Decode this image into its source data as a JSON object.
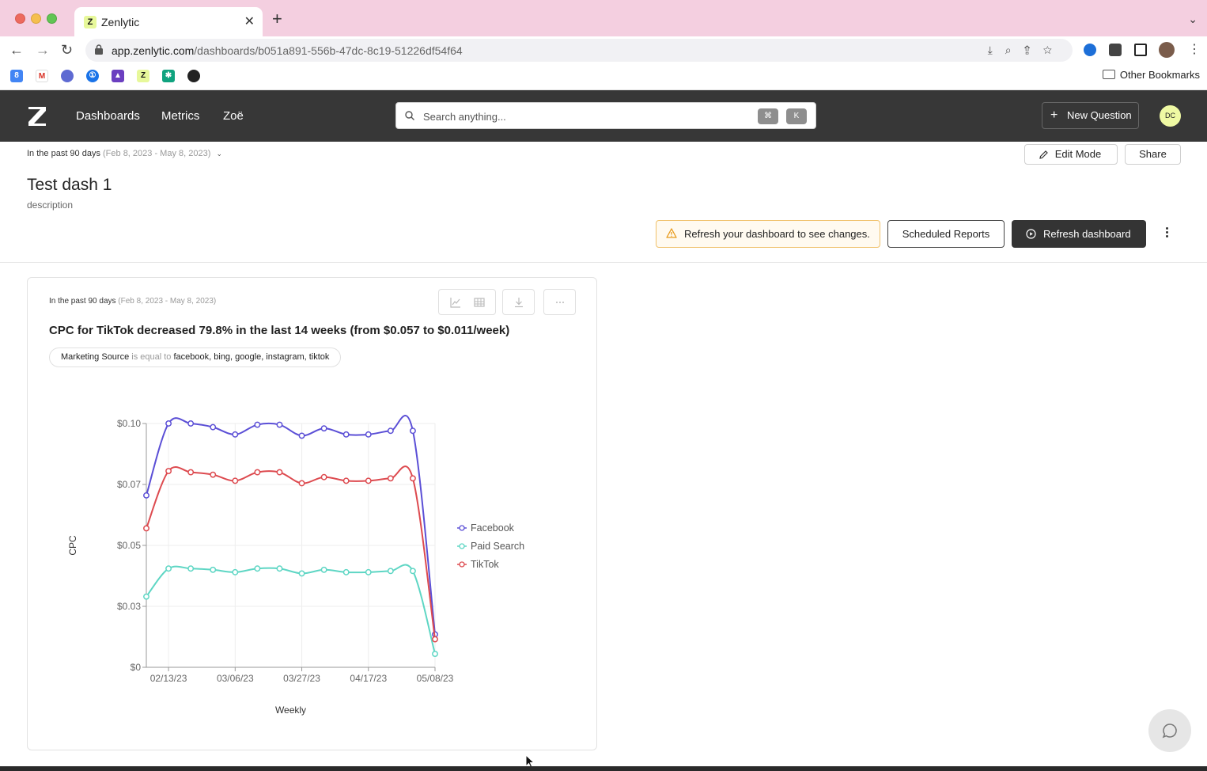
{
  "browser": {
    "tab_title": "Zenlytic",
    "tab_favicon": "Z",
    "url_host": "app.zenlytic.com",
    "url_path": "/dashboards/b051a891-556b-47dc-8c19-51226df54f64",
    "other_bookmarks": "Other Bookmarks",
    "bookmark_icons": [
      "calendar-icon",
      "gmail-icon",
      "linear-icon",
      "onepassword-icon",
      "arc-icon",
      "zenlytic-icon",
      "openai-icon",
      "github-icon"
    ]
  },
  "appbar": {
    "nav": [
      "Dashboards",
      "Metrics",
      "Zoë"
    ],
    "search_placeholder": "Search anything...",
    "shortcut_keys": [
      "⌘",
      "K"
    ],
    "new_question": "New Question",
    "avatar_initials": "DC"
  },
  "dashboard": {
    "date_range_label": "In the past 90 days",
    "date_range_dates": "(Feb 8, 2023 - May 8, 2023)",
    "edit_mode": "Edit Mode",
    "share": "Share",
    "title": "Test dash 1",
    "description": "description",
    "notice": "Refresh your dashboard to see changes.",
    "scheduled_reports": "Scheduled Reports",
    "refresh_dashboard": "Refresh dashboard"
  },
  "card": {
    "date_range_label": "In the past 90 days",
    "date_range_dates": "(Feb 8, 2023 - May 8, 2023)",
    "title": "CPC for TikTok decreased 79.8% in the last 14 weeks (from $0.057 to $0.011/week)",
    "filter_field": "Marketing Source",
    "filter_op": "is equal to",
    "filter_values": "facebook, bing, google, instagram, tiktok"
  },
  "chart_data": {
    "type": "line",
    "xlabel": "Weekly",
    "ylabel": "CPC",
    "ylim": [
      0,
      0.1
    ],
    "y_ticks": [
      "$0",
      "$0.03",
      "$0.05",
      "$0.07",
      "$0.10"
    ],
    "y_tick_values": [
      0,
      0.025,
      0.05,
      0.075,
      0.1
    ],
    "x_tick_labels": [
      "02/13/23",
      "03/06/23",
      "03/27/23",
      "04/17/23",
      "05/08/23"
    ],
    "x_tick_index": [
      1,
      4,
      7,
      10,
      13
    ],
    "x": [
      "02/06/23",
      "02/13/23",
      "02/20/23",
      "02/27/23",
      "03/06/23",
      "03/13/23",
      "03/20/23",
      "03/27/23",
      "04/03/23",
      "04/10/23",
      "04/17/23",
      "04/24/23",
      "05/01/23",
      "05/08/23"
    ],
    "legend_position": "right",
    "grid": true,
    "series": [
      {
        "name": "Facebook",
        "color": "#5b4fd6",
        "values": [
          0.0705,
          0.1,
          0.1,
          0.0985,
          0.0955,
          0.0995,
          0.0995,
          0.095,
          0.098,
          0.0955,
          0.0955,
          0.097,
          0.097,
          0.0135
        ]
      },
      {
        "name": "Paid Search",
        "color": "#5ed6c4",
        "values": [
          0.029,
          0.0405,
          0.0405,
          0.04,
          0.039,
          0.0405,
          0.0405,
          0.0385,
          0.04,
          0.039,
          0.039,
          0.0395,
          0.0395,
          0.0055
        ]
      },
      {
        "name": "TikTok",
        "color": "#dd4a4f",
        "values": [
          0.057,
          0.0805,
          0.08,
          0.079,
          0.0765,
          0.08,
          0.08,
          0.0755,
          0.078,
          0.0765,
          0.0765,
          0.0775,
          0.0775,
          0.0115
        ]
      }
    ]
  }
}
